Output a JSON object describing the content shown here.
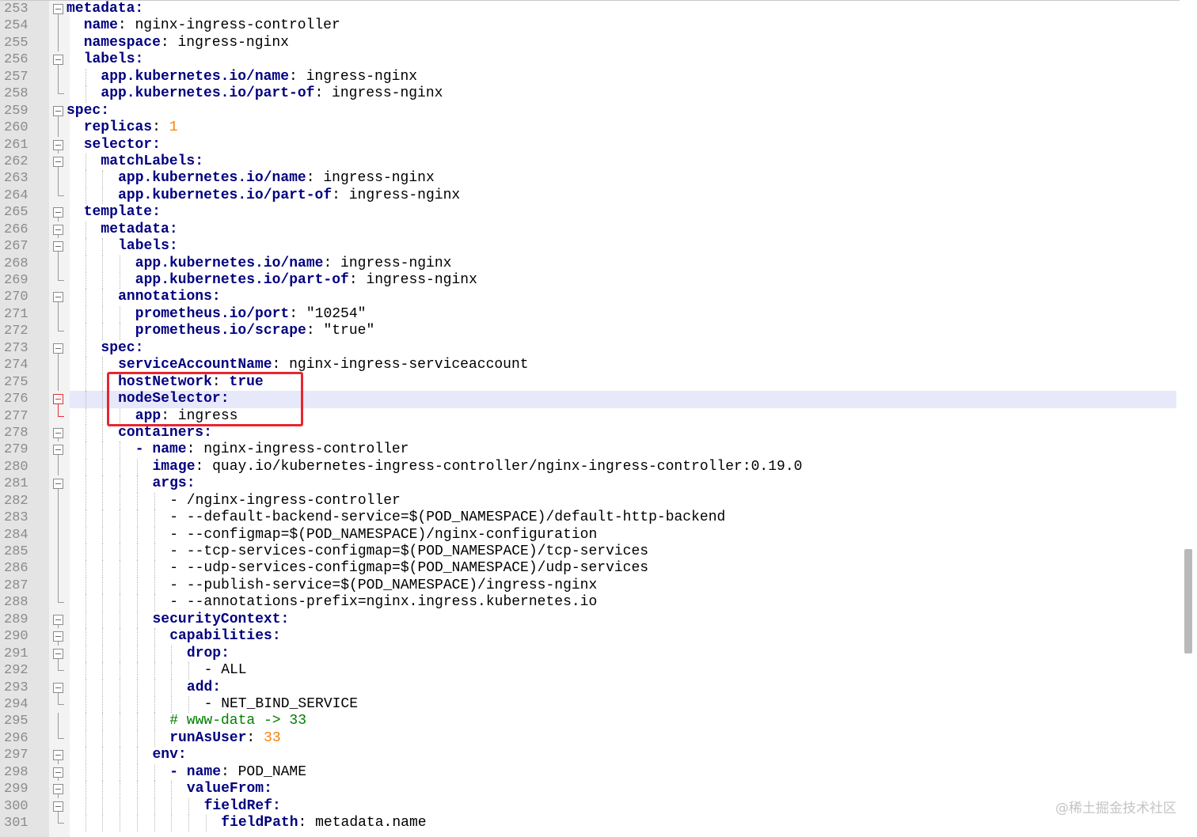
{
  "editor": {
    "language": "yaml",
    "highlighted_line": 276,
    "watermark": "@稀土掘金技术社区",
    "colors": {
      "key": "#000080",
      "number": "#ff8000",
      "comment": "#008000",
      "line_number": "#8b8b8b",
      "current_line": "#e8e8fb",
      "annotation_box": "#e8262e"
    },
    "annotation": {
      "shape": "rectangle",
      "from_line": 275,
      "to_line": 277
    },
    "scrollbar": {
      "position_fraction": 0.66
    },
    "lines": [
      {
        "num": "253",
        "indent": 0,
        "fold": "open",
        "tokens": [
          {
            "t": "metadata",
            "s": "k"
          },
          {
            "t": ":",
            "s": "k"
          }
        ]
      },
      {
        "num": "254",
        "indent": 2,
        "fold": "line",
        "tokens": [
          {
            "t": "name",
            "s": "k"
          },
          {
            "t": ": nginx-ingress-controller",
            "s": ""
          }
        ]
      },
      {
        "num": "255",
        "indent": 2,
        "fold": "line",
        "tokens": [
          {
            "t": "namespace",
            "s": "k"
          },
          {
            "t": ": ingress-nginx",
            "s": ""
          }
        ]
      },
      {
        "num": "256",
        "indent": 2,
        "fold": "open",
        "tokens": [
          {
            "t": "labels",
            "s": "k"
          },
          {
            "t": ":",
            "s": "k"
          }
        ]
      },
      {
        "num": "257",
        "indent": 4,
        "fold": "line",
        "tokens": [
          {
            "t": "app.kubernetes.io/name",
            "s": "k"
          },
          {
            "t": ": ingress-nginx",
            "s": ""
          }
        ]
      },
      {
        "num": "258",
        "indent": 4,
        "fold": "end",
        "tokens": [
          {
            "t": "app.kubernetes.io/part-of",
            "s": "k"
          },
          {
            "t": ": ingress-nginx",
            "s": ""
          }
        ]
      },
      {
        "num": "259",
        "indent": 0,
        "fold": "open",
        "tokens": [
          {
            "t": "spec",
            "s": "k"
          },
          {
            "t": ":",
            "s": "k"
          }
        ]
      },
      {
        "num": "260",
        "indent": 2,
        "fold": "line",
        "tokens": [
          {
            "t": "replicas",
            "s": "k"
          },
          {
            "t": ": ",
            "s": ""
          },
          {
            "t": "1",
            "s": "n"
          }
        ]
      },
      {
        "num": "261",
        "indent": 2,
        "fold": "open",
        "tokens": [
          {
            "t": "selector",
            "s": "k"
          },
          {
            "t": ":",
            "s": "k"
          }
        ]
      },
      {
        "num": "262",
        "indent": 4,
        "fold": "open",
        "tokens": [
          {
            "t": "matchLabels",
            "s": "k"
          },
          {
            "t": ":",
            "s": "k"
          }
        ]
      },
      {
        "num": "263",
        "indent": 6,
        "fold": "line",
        "tokens": [
          {
            "t": "app.kubernetes.io/name",
            "s": "k"
          },
          {
            "t": ": ingress-nginx",
            "s": ""
          }
        ]
      },
      {
        "num": "264",
        "indent": 6,
        "fold": "end",
        "tokens": [
          {
            "t": "app.kubernetes.io/part-of",
            "s": "k"
          },
          {
            "t": ": ingress-nginx",
            "s": ""
          }
        ]
      },
      {
        "num": "265",
        "indent": 2,
        "fold": "open",
        "tokens": [
          {
            "t": "template",
            "s": "k"
          },
          {
            "t": ":",
            "s": "k"
          }
        ]
      },
      {
        "num": "266",
        "indent": 4,
        "fold": "open",
        "tokens": [
          {
            "t": "metadata",
            "s": "k"
          },
          {
            "t": ":",
            "s": "k"
          }
        ]
      },
      {
        "num": "267",
        "indent": 6,
        "fold": "open",
        "tokens": [
          {
            "t": "labels",
            "s": "k"
          },
          {
            "t": ":",
            "s": "k"
          }
        ]
      },
      {
        "num": "268",
        "indent": 8,
        "fold": "line",
        "tokens": [
          {
            "t": "app.kubernetes.io/name",
            "s": "k"
          },
          {
            "t": ": ingress-nginx",
            "s": ""
          }
        ]
      },
      {
        "num": "269",
        "indent": 8,
        "fold": "end",
        "tokens": [
          {
            "t": "app.kubernetes.io/part-of",
            "s": "k"
          },
          {
            "t": ": ingress-nginx",
            "s": ""
          }
        ]
      },
      {
        "num": "270",
        "indent": 6,
        "fold": "open",
        "tokens": [
          {
            "t": "annotations",
            "s": "k"
          },
          {
            "t": ":",
            "s": "k"
          }
        ]
      },
      {
        "num": "271",
        "indent": 8,
        "fold": "line",
        "tokens": [
          {
            "t": "prometheus.io/port",
            "s": "k"
          },
          {
            "t": ": \"10254\"",
            "s": ""
          }
        ]
      },
      {
        "num": "272",
        "indent": 8,
        "fold": "end",
        "tokens": [
          {
            "t": "prometheus.io/scrape",
            "s": "k"
          },
          {
            "t": ": \"true\"",
            "s": ""
          }
        ]
      },
      {
        "num": "273",
        "indent": 4,
        "fold": "open",
        "tokens": [
          {
            "t": "spec",
            "s": "k"
          },
          {
            "t": ":",
            "s": "k"
          }
        ]
      },
      {
        "num": "274",
        "indent": 6,
        "fold": "line",
        "tokens": [
          {
            "t": "serviceAccountName",
            "s": "k"
          },
          {
            "t": ": nginx-ingress-serviceaccount",
            "s": ""
          }
        ]
      },
      {
        "num": "275",
        "indent": 6,
        "fold": "line",
        "tokens": [
          {
            "t": "hostNetwork",
            "s": "k"
          },
          {
            "t": ": ",
            "s": ""
          },
          {
            "t": "true",
            "s": "bv"
          }
        ]
      },
      {
        "num": "276",
        "indent": 6,
        "fold": "open-red",
        "tokens": [
          {
            "t": "nodeSelector",
            "s": "k"
          },
          {
            "t": ":",
            "s": "k"
          }
        ]
      },
      {
        "num": "277",
        "indent": 8,
        "fold": "end-red",
        "tokens": [
          {
            "t": "app",
            "s": "k"
          },
          {
            "t": ": ingress",
            "s": ""
          }
        ]
      },
      {
        "num": "278",
        "indent": 6,
        "fold": "open",
        "tokens": [
          {
            "t": "containers",
            "s": "k"
          },
          {
            "t": ":",
            "s": "k"
          }
        ]
      },
      {
        "num": "279",
        "indent": 8,
        "fold": "open",
        "tokens": [
          {
            "t": "- ",
            "s": "k"
          },
          {
            "t": "name",
            "s": "k"
          },
          {
            "t": ": nginx-ingress-controller",
            "s": ""
          }
        ]
      },
      {
        "num": "280",
        "indent": 10,
        "fold": "line",
        "tokens": [
          {
            "t": "image",
            "s": "k"
          },
          {
            "t": ": quay.io/kubernetes-ingress-controller/nginx-ingress-controller:0.19.0",
            "s": ""
          }
        ]
      },
      {
        "num": "281",
        "indent": 10,
        "fold": "open",
        "tokens": [
          {
            "t": "args",
            "s": "k"
          },
          {
            "t": ":",
            "s": "k"
          }
        ]
      },
      {
        "num": "282",
        "indent": 12,
        "fold": "line",
        "tokens": [
          {
            "t": "- /nginx-ingress-controller",
            "s": ""
          }
        ]
      },
      {
        "num": "283",
        "indent": 12,
        "fold": "line",
        "tokens": [
          {
            "t": "- --default-backend-service=$(POD_NAMESPACE)/default-http-backend",
            "s": ""
          }
        ]
      },
      {
        "num": "284",
        "indent": 12,
        "fold": "line",
        "tokens": [
          {
            "t": "- --configmap=$(POD_NAMESPACE)/nginx-configuration",
            "s": ""
          }
        ]
      },
      {
        "num": "285",
        "indent": 12,
        "fold": "line",
        "tokens": [
          {
            "t": "- --tcp-services-configmap=$(POD_NAMESPACE)/tcp-services",
            "s": ""
          }
        ]
      },
      {
        "num": "286",
        "indent": 12,
        "fold": "line",
        "tokens": [
          {
            "t": "- --udp-services-configmap=$(POD_NAMESPACE)/udp-services",
            "s": ""
          }
        ]
      },
      {
        "num": "287",
        "indent": 12,
        "fold": "line",
        "tokens": [
          {
            "t": "- --publish-service=$(POD_NAMESPACE)/ingress-nginx",
            "s": ""
          }
        ]
      },
      {
        "num": "288",
        "indent": 12,
        "fold": "end",
        "tokens": [
          {
            "t": "- --annotations-prefix=nginx.ingress.kubernetes.io",
            "s": ""
          }
        ]
      },
      {
        "num": "289",
        "indent": 10,
        "fold": "open",
        "tokens": [
          {
            "t": "securityContext",
            "s": "k"
          },
          {
            "t": ":",
            "s": "k"
          }
        ]
      },
      {
        "num": "290",
        "indent": 12,
        "fold": "open",
        "tokens": [
          {
            "t": "capabilities",
            "s": "k"
          },
          {
            "t": ":",
            "s": "k"
          }
        ]
      },
      {
        "num": "291",
        "indent": 14,
        "fold": "open",
        "tokens": [
          {
            "t": "drop",
            "s": "k"
          },
          {
            "t": ":",
            "s": "k"
          }
        ]
      },
      {
        "num": "292",
        "indent": 16,
        "fold": "end",
        "tokens": [
          {
            "t": "- ALL",
            "s": ""
          }
        ]
      },
      {
        "num": "293",
        "indent": 14,
        "fold": "open",
        "tokens": [
          {
            "t": "add",
            "s": "k"
          },
          {
            "t": ":",
            "s": "k"
          }
        ]
      },
      {
        "num": "294",
        "indent": 16,
        "fold": "end",
        "tokens": [
          {
            "t": "- NET_BIND_SERVICE",
            "s": ""
          }
        ]
      },
      {
        "num": "295",
        "indent": 12,
        "fold": "line",
        "tokens": [
          {
            "t": "# www-data -> 33",
            "s": "c"
          }
        ]
      },
      {
        "num": "296",
        "indent": 12,
        "fold": "end",
        "tokens": [
          {
            "t": "runAsUser",
            "s": "k"
          },
          {
            "t": ": ",
            "s": ""
          },
          {
            "t": "33",
            "s": "n"
          }
        ]
      },
      {
        "num": "297",
        "indent": 10,
        "fold": "open",
        "tokens": [
          {
            "t": "env",
            "s": "k"
          },
          {
            "t": ":",
            "s": "k"
          }
        ]
      },
      {
        "num": "298",
        "indent": 12,
        "fold": "open",
        "tokens": [
          {
            "t": "- ",
            "s": "k"
          },
          {
            "t": "name",
            "s": "k"
          },
          {
            "t": ": POD_NAME",
            "s": ""
          }
        ]
      },
      {
        "num": "299",
        "indent": 14,
        "fold": "open",
        "tokens": [
          {
            "t": "valueFrom",
            "s": "k"
          },
          {
            "t": ":",
            "s": "k"
          }
        ]
      },
      {
        "num": "300",
        "indent": 16,
        "fold": "open",
        "tokens": [
          {
            "t": "fieldRef",
            "s": "k"
          },
          {
            "t": ":",
            "s": "k"
          }
        ]
      },
      {
        "num": "301",
        "indent": 18,
        "fold": "end",
        "tokens": [
          {
            "t": "fieldPath",
            "s": "k"
          },
          {
            "t": ": metadata.name",
            "s": ""
          }
        ]
      }
    ]
  }
}
